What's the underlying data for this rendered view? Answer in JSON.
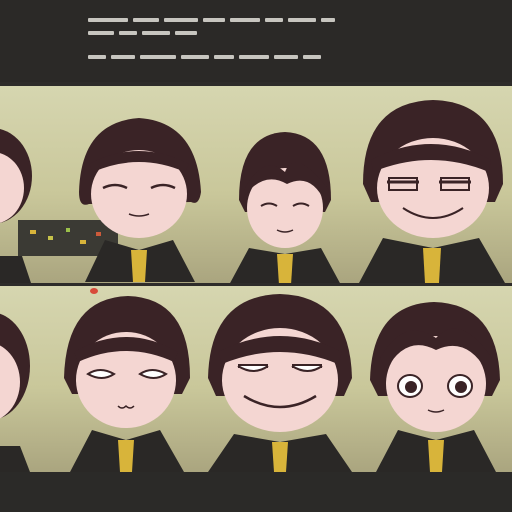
{
  "header": {
    "caption_line_1": "",
    "caption_line_2": ""
  },
  "panels": {
    "top": [
      "character-1",
      "character-2",
      "character-3",
      "character-4"
    ],
    "bottom": [
      "character-5",
      "character-6",
      "character-7",
      "character-8"
    ]
  },
  "colors": {
    "background": "#2e2c2a",
    "panel": "#d2d1a8",
    "hair": "#3a2326",
    "skin": "#f4d6d2",
    "coat": "#2a2826",
    "shirt": "#d8b43a"
  }
}
